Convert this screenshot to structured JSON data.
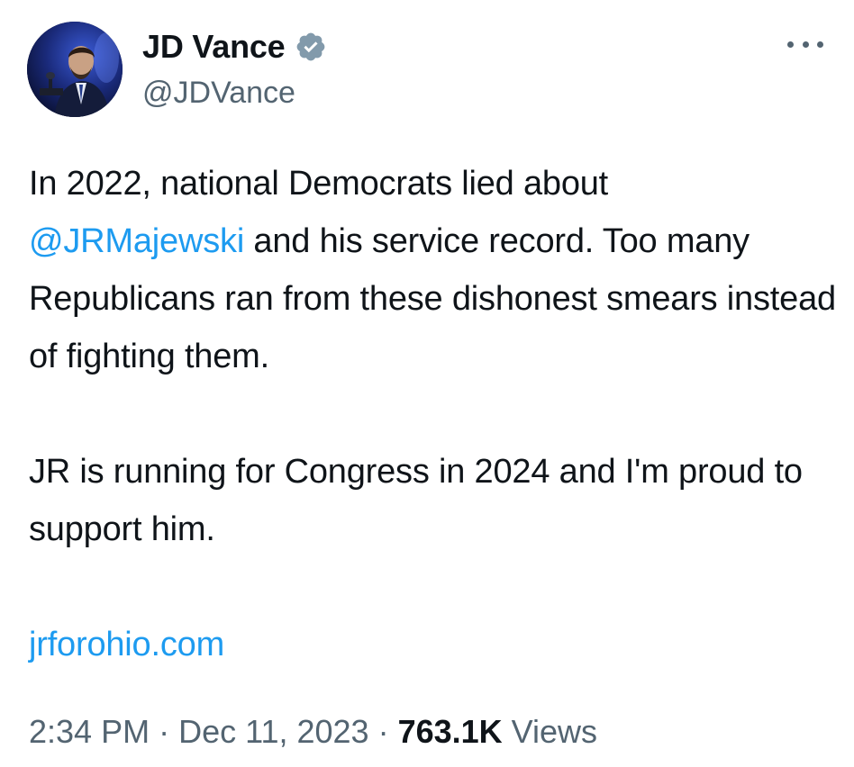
{
  "author": {
    "display_name": "JD Vance",
    "handle": "@JDVance",
    "verified_icon": "verified-badge-icon",
    "avatar": "profile-photo-avatar"
  },
  "more_icon": "more-options-icon",
  "tweet": {
    "para1_prefix": "In 2022, national Democrats lied about",
    "mention": "@JRMajewski",
    "para1_suffix": " and his service record. Too many Republicans ran from these dishonest smears instead of fighting them.",
    "para2": "JR is running for Congress in 2024 and I'm proud to support him.",
    "link": "jrforohio.com"
  },
  "meta": {
    "time": "2:34 PM",
    "separator": " · ",
    "date": "Dec 11, 2023",
    "views_count": "763.1K",
    "views_label": " Views"
  },
  "colors": {
    "link": "#1d9bf0",
    "text": "#0f1419",
    "secondary": "#536471",
    "verified": "#829aab"
  }
}
